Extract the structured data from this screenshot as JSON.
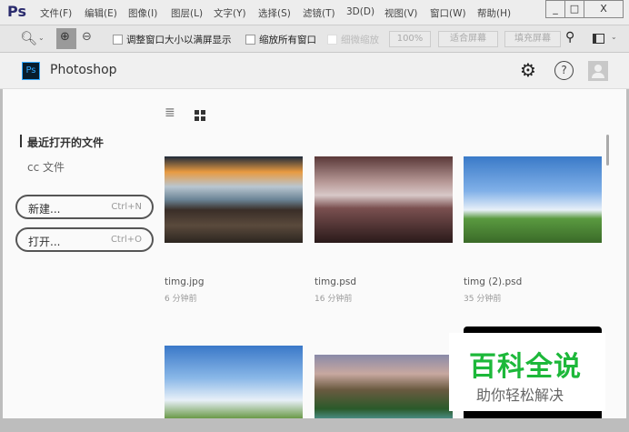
{
  "app": {
    "logo": "Ps",
    "menu": [
      "文件(F)",
      "编辑(E)",
      "图像(I)",
      "图层(L)",
      "文字(Y)",
      "选择(S)",
      "滤镜(T)",
      "3D(D)",
      "视图(V)",
      "窗口(W)",
      "帮助(H)"
    ],
    "window_controls": [
      "_",
      "□",
      "X"
    ]
  },
  "toolbar": {
    "resize_windows": "调整窗口大小以满屏显示",
    "zoom_all": "缩放所有窗口",
    "scrubby": "细微缩放",
    "zoom_100": "100%",
    "fit_screen": "适合屏幕",
    "fill_screen": "填充屏幕"
  },
  "header": {
    "ps_badge": "Ps",
    "title": "Photoshop"
  },
  "sidebar": {
    "recent": "最近打开的文件",
    "cc_files": "cc 文件",
    "new_label": "新建...",
    "new_shortcut": "Ctrl+N",
    "open_label": "打开...",
    "open_shortcut": "Ctrl+O"
  },
  "files": [
    {
      "name": "timg.jpg",
      "time": "6 分钟前"
    },
    {
      "name": "timg.psd",
      "time": "16 分钟前"
    },
    {
      "name": "timg (2).psd",
      "time": "35 分钟前"
    }
  ],
  "watermark": {
    "title": "百科全说",
    "subtitle": "助你轻松解决"
  }
}
